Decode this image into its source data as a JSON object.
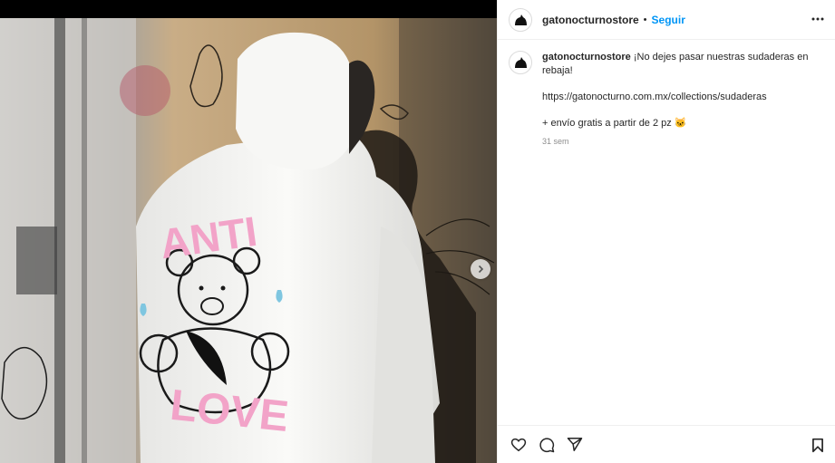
{
  "post": {
    "username": "gatonocturnostore",
    "dot": "•",
    "follow_label": "Seguir",
    "caption_text": "¡No dejes pasar nuestras sudaderas en rebaja!",
    "caption_link": "https://gatonocturno.com.mx/collections/sudaderas",
    "caption_extra": "+ envío gratis a partir de 2 pz 🐱",
    "time_ago": "31 sem"
  },
  "media": {
    "hoodie_print_top": "ANTI",
    "hoodie_print_bottom": "LOVE",
    "colors": {
      "hoodie": "#f4f4f2",
      "print_pink": "#f2a3c8",
      "wall": "#b89a74",
      "shadow": "#1e1a15"
    }
  },
  "icons": {
    "more": "more-horizontal-icon",
    "next": "chevron-right-icon",
    "like": "heart-icon",
    "comment": "comment-icon",
    "share": "send-icon",
    "save": "bookmark-icon"
  }
}
